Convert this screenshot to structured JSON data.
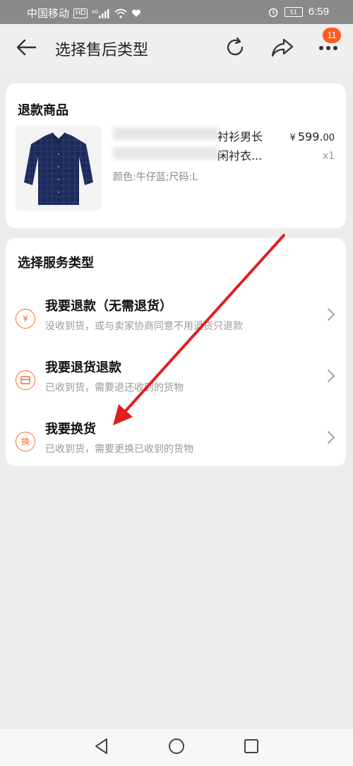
{
  "status_bar": {
    "carrier": "中国移动",
    "hd": "HD",
    "network": "4G",
    "battery": "51",
    "time": "6:59"
  },
  "header": {
    "title": "选择售后类型",
    "more_badge": "11"
  },
  "refund_card": {
    "title": "退款商品",
    "product": {
      "name_visible": "衬衫男长 闲衬衣...",
      "spec": "颜色:牛仔蓝;尺码:L",
      "price_currency": "¥",
      "price_int": "599.",
      "price_dec": "00",
      "qty": "x1"
    }
  },
  "service_card": {
    "title": "选择服务类型",
    "options": [
      {
        "icon": "yen-icon",
        "icon_text": "¥",
        "title": "我要退款（无需退货）",
        "subtitle": "没收到货，或与卖家协商同意不用退货只退款"
      },
      {
        "icon": "return-box-icon",
        "icon_text": "",
        "title": "我要退货退款",
        "subtitle": "已收到货，需要退还收到的货物"
      },
      {
        "icon": "exchange-icon",
        "icon_text": "换",
        "title": "我要换货",
        "subtitle": "已收到货，需要更换已收到的货物"
      }
    ]
  },
  "colors": {
    "accent": "#ff6a2a",
    "annotation_arrow": "#e02020",
    "badge": "#ff5a1f"
  }
}
